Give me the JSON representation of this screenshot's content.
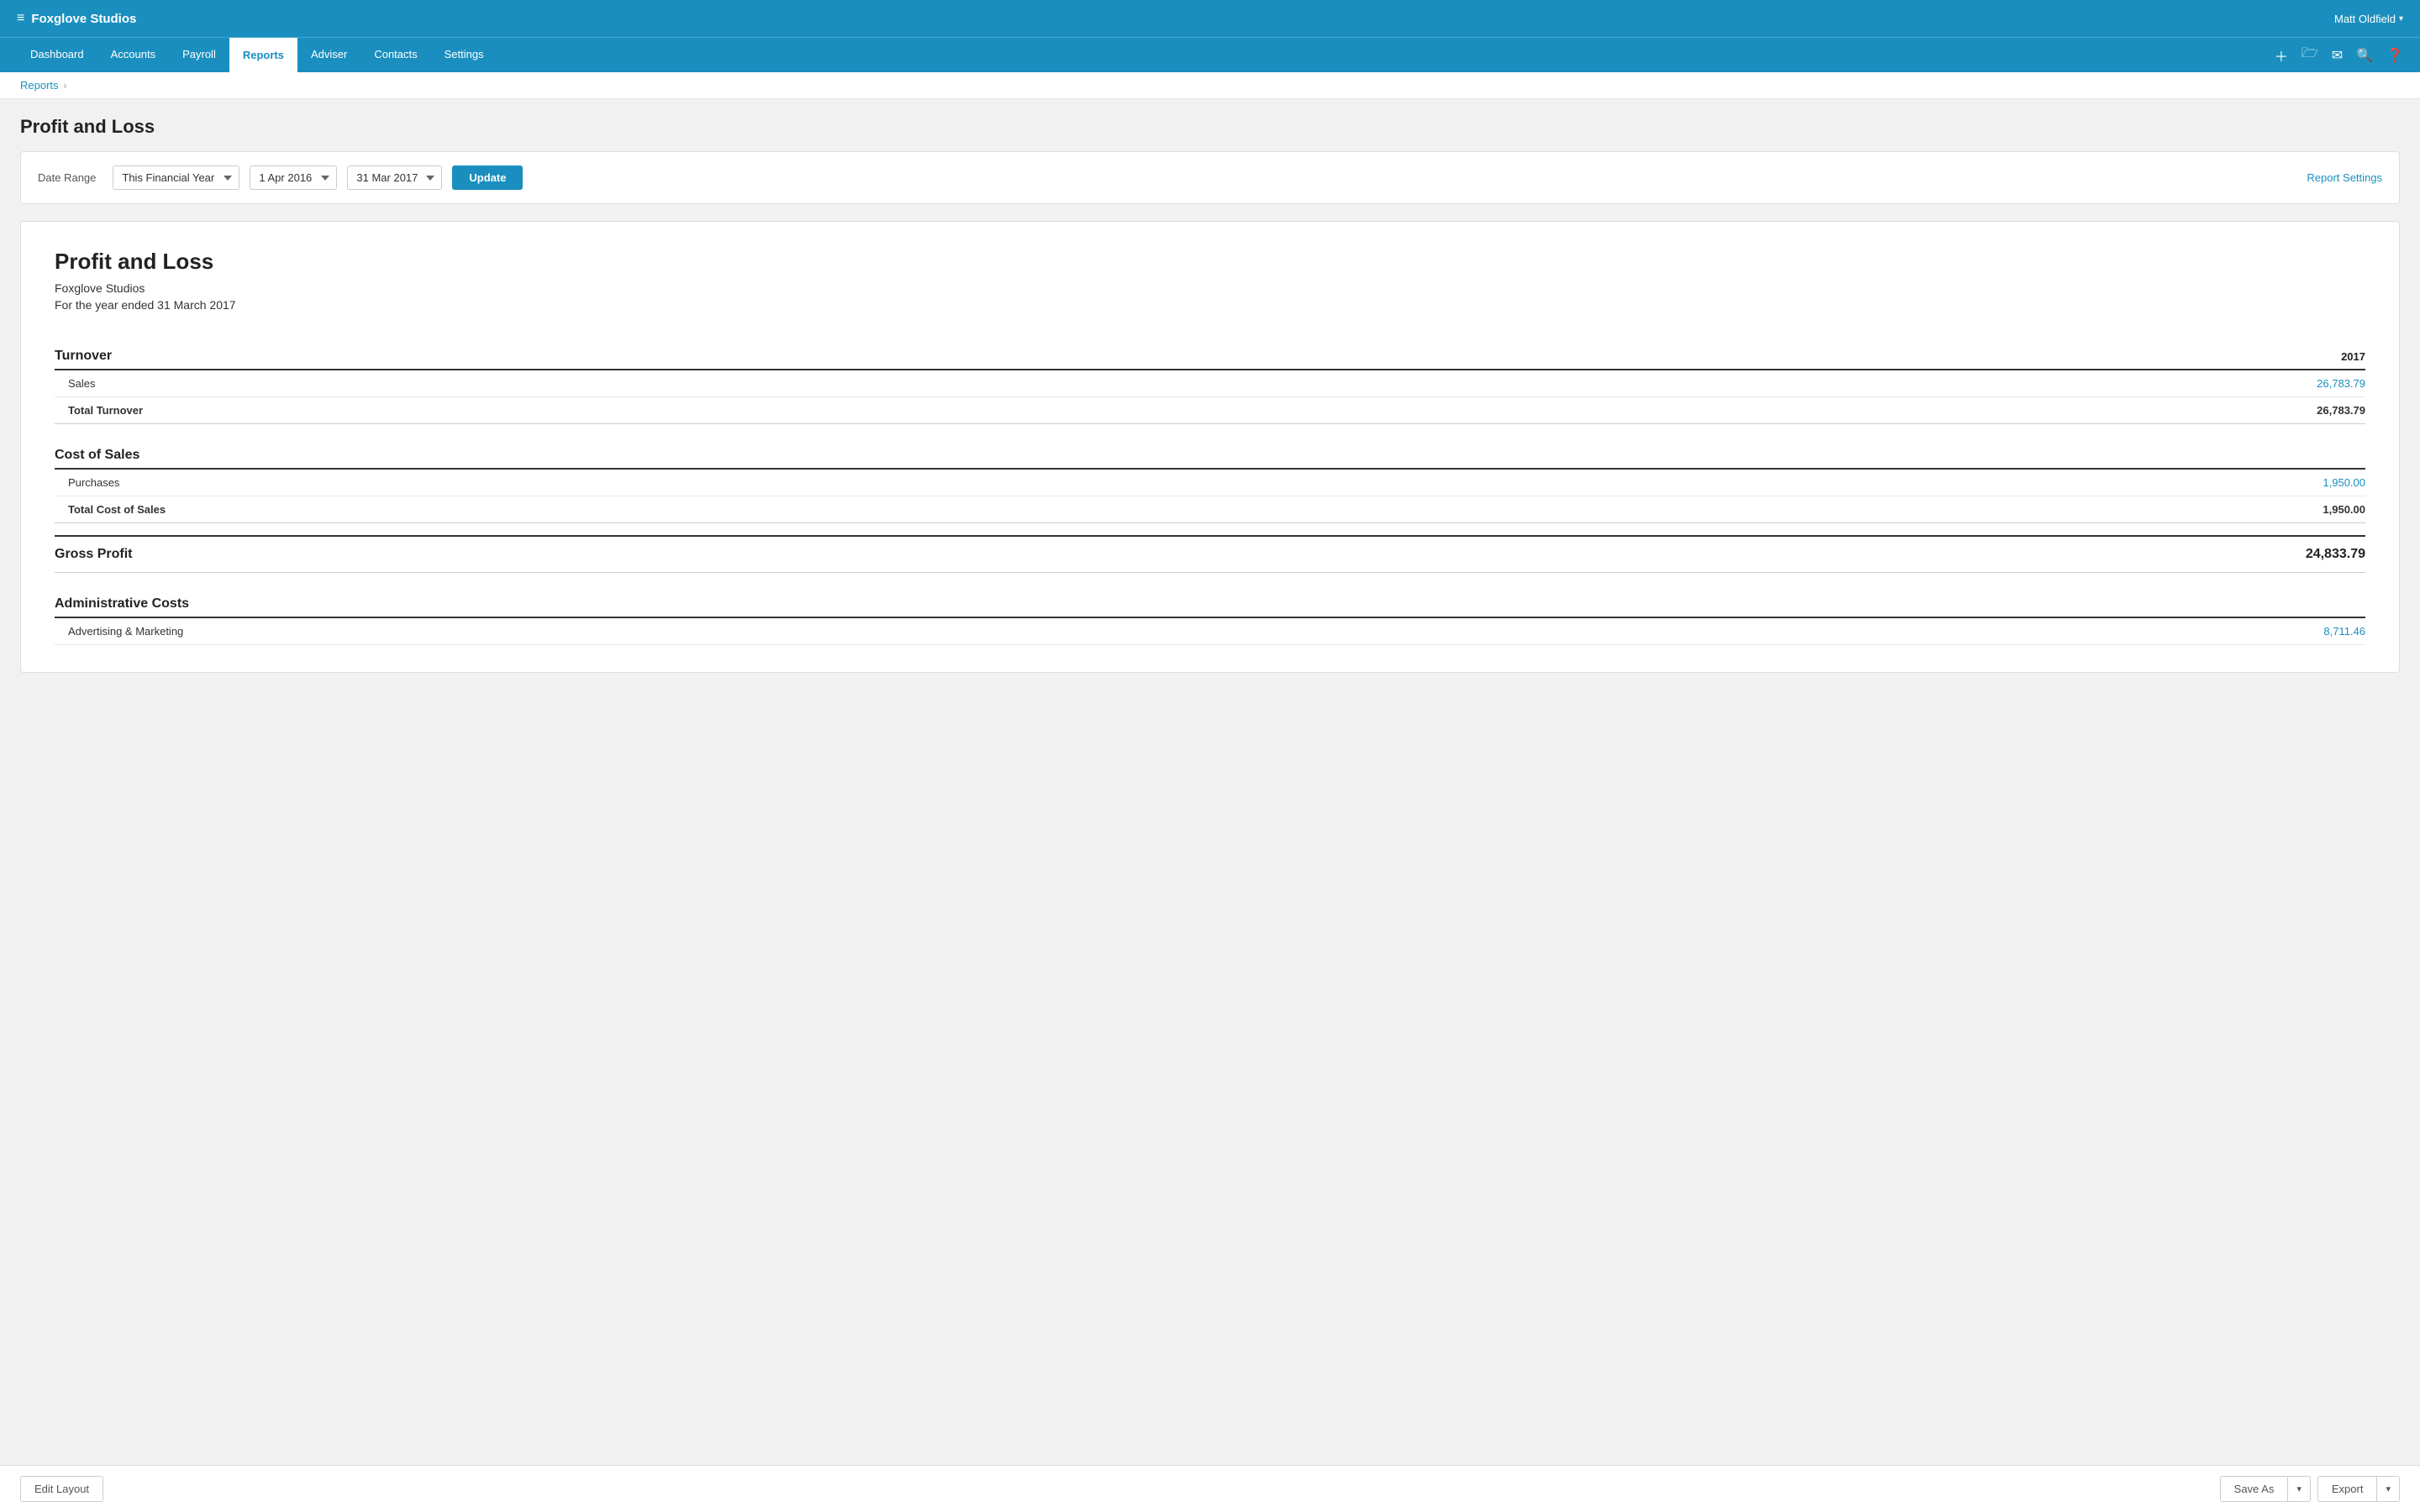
{
  "app": {
    "logo": "≡",
    "company_name": "Foxglove Studios",
    "user_name": "Matt Oldfield"
  },
  "nav": {
    "items": [
      {
        "label": "Dashboard",
        "active": false
      },
      {
        "label": "Accounts",
        "active": false
      },
      {
        "label": "Payroll",
        "active": false
      },
      {
        "label": "Reports",
        "active": true
      },
      {
        "label": "Adviser",
        "active": false
      },
      {
        "label": "Contacts",
        "active": false
      },
      {
        "label": "Settings",
        "active": false
      }
    ]
  },
  "breadcrumb": {
    "link_label": "Reports",
    "separator": "›"
  },
  "page": {
    "title": "Profit and Loss"
  },
  "filter": {
    "label": "Date Range",
    "date_range_value": "This Financial Year",
    "date_from_value": "1 Apr 2016",
    "date_to_value": "31 Mar 2017",
    "update_label": "Update",
    "report_settings_label": "Report Settings"
  },
  "report": {
    "title": "Profit and Loss",
    "company": "Foxglove Studios",
    "period": "For the year ended 31 March 2017",
    "year_header": "2017",
    "sections": {
      "turnover": {
        "header": "Turnover",
        "rows": [
          {
            "label": "Sales",
            "amount": "26,783.79",
            "clickable": true
          }
        ],
        "total_label": "Total Turnover",
        "total_amount": "26,783.79"
      },
      "cost_of_sales": {
        "header": "Cost of Sales",
        "rows": [
          {
            "label": "Purchases",
            "amount": "1,950.00",
            "clickable": true
          }
        ],
        "total_label": "Total Cost of Sales",
        "total_amount": "1,950.00"
      },
      "gross_profit": {
        "label": "Gross Profit",
        "amount": "24,833.79"
      },
      "administrative_costs": {
        "header": "Administrative Costs",
        "rows": [
          {
            "label": "Advertising & Marketing",
            "amount": "8,711.46",
            "clickable": true
          }
        ]
      }
    }
  },
  "bottom_bar": {
    "edit_layout_label": "Edit Layout",
    "save_as_label": "Save As",
    "export_label": "Export"
  }
}
